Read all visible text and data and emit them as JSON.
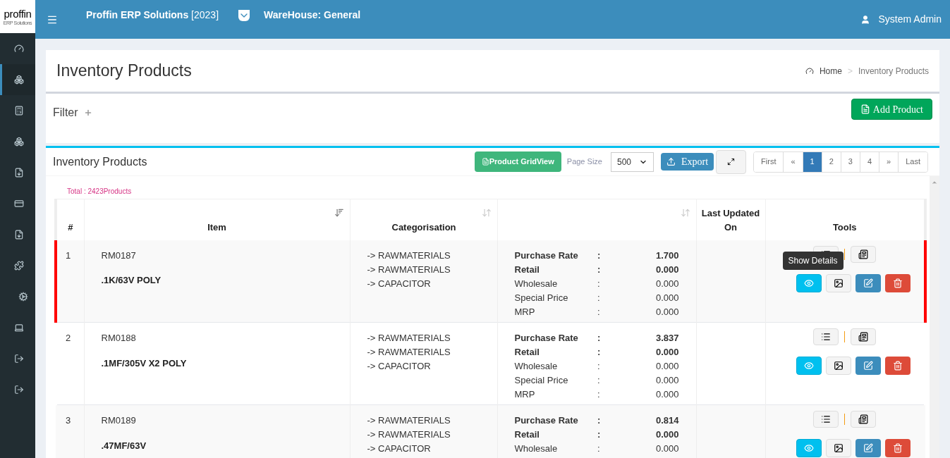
{
  "logo": {
    "name": "proffin",
    "tagline": "ERP Solutions"
  },
  "topbar": {
    "title": "**Proffin ERP Solutions** [2023]",
    "warehouse": "WareHouse: General",
    "user": "System Admin"
  },
  "sidebar": {
    "items": [
      {
        "selected": false
      },
      {
        "selected": true
      },
      {
        "selected": false
      },
      {
        "selected": false
      },
      {
        "selected": false
      },
      {
        "selected": false
      },
      {
        "selected": false
      },
      {
        "selected": false
      },
      {
        "selected": false
      },
      {
        "selected": false
      },
      {
        "selected": false
      },
      {
        "selected": false
      }
    ]
  },
  "page": {
    "title": "Inventory Products",
    "breadcrumb": [
      "Home",
      ">",
      "Inventory Products"
    ]
  },
  "filter": {
    "label": "Filter",
    "add_button": "Add Product"
  },
  "panel": {
    "title": "Inventory Products",
    "grid_button": "Product GridView",
    "page_size_label": "Page Size",
    "page_size": "500",
    "export_button": "Export",
    "pagination": [
      {
        "label": "First",
        "selected": false
      },
      {
        "label": "«",
        "selected": false
      },
      {
        "label": "1",
        "selected": true
      },
      {
        "label": "2",
        "selected": false
      },
      {
        "label": "3",
        "selected": false
      },
      {
        "label": "4",
        "selected": false
      },
      {
        "label": "»",
        "selected": false
      },
      {
        "label": "Last",
        "selected": false
      }
    ],
    "total": "Total : 2423Products"
  },
  "table": {
    "columns": [
      {
        "label": "#"
      },
      {
        "label": "Item",
        "sorted": true
      },
      {
        "label": "Categorisation",
        "sorted": false
      },
      {
        "sorted": false
      },
      {
        "label": "Last Updated On"
      },
      {
        "label": "Tools"
      }
    ],
    "rows": [
      {
        "number": "1",
        "code": "RM0187",
        "name": ".1K/63V POLY",
        "categories": [
          "-> RAWMATERIALS",
          "-> RAWMATERIALS",
          "-> CAPACITOR"
        ],
        "selected": true,
        "tooltip": "Show Details",
        "rates": [
          {
            "label": "Purchase Rate",
            "sep": ":",
            "value": "1.700",
            "bold": true
          },
          {
            "label": "Retail",
            "sep": ":",
            "value": "0.000",
            "bold": true
          },
          {
            "label": "Wholesale",
            "sep": ":",
            "value": "0.000",
            "bold": false
          },
          {
            "label": "Special Price",
            "sep": ":",
            "value": "0.000",
            "bold": false
          },
          {
            "label": "MRP",
            "sep": ":",
            "value": "0.000",
            "bold": false
          }
        ]
      },
      {
        "number": "2",
        "code": "RM0188",
        "name": ".1MF/305V X2 POLY",
        "categories": [
          "-> RAWMATERIALS",
          "-> RAWMATERIALS",
          "-> CAPACITOR"
        ],
        "selected": false,
        "rates": [
          {
            "label": "Purchase Rate",
            "sep": ":",
            "value": "3.837",
            "bold": true
          },
          {
            "label": "Retail",
            "sep": ":",
            "value": "0.000",
            "bold": true
          },
          {
            "label": "Wholesale",
            "sep": ":",
            "value": "0.000",
            "bold": false
          },
          {
            "label": "Special Price",
            "sep": ":",
            "value": "0.000",
            "bold": false
          },
          {
            "label": "MRP",
            "sep": ":",
            "value": "0.000",
            "bold": false
          }
        ]
      },
      {
        "number": "3",
        "code": "RM0189",
        "name": ".47MF/63V",
        "categories": [
          "-> RAWMATERIALS",
          "-> RAWMATERIALS",
          "-> CAPACITOR"
        ],
        "selected": false,
        "rates": [
          {
            "label": "Purchase Rate",
            "sep": ":",
            "value": "0.814",
            "bold": true
          },
          {
            "label": "Retail",
            "sep": ":",
            "value": "0.000",
            "bold": true
          },
          {
            "label": "Wholesale",
            "sep": ":",
            "value": "0.000",
            "bold": false
          }
        ]
      }
    ]
  }
}
